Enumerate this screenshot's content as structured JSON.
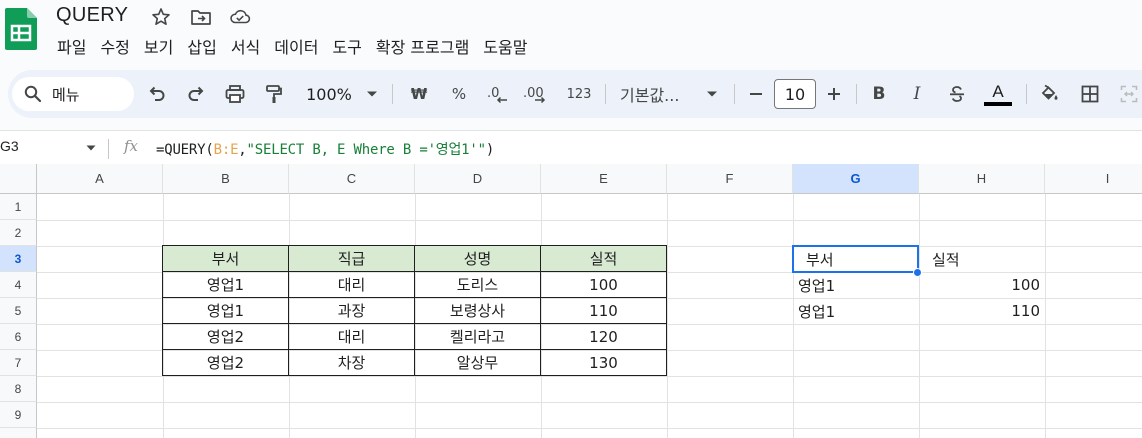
{
  "app": {
    "title": "QUERY",
    "accent_color": "#0f9d58"
  },
  "menu": [
    "파일",
    "수정",
    "보기",
    "삽입",
    "서식",
    "데이터",
    "도구",
    "확장 프로그램",
    "도움말"
  ],
  "toolbar": {
    "search_label": "메뉴",
    "zoom": "100%",
    "currency": "₩",
    "percent": "%",
    "format_number": "123",
    "font_family": "기본값...",
    "font_size": "10",
    "bold": "B",
    "italic": "I",
    "text_color_letter": "A"
  },
  "formula_bar": {
    "name_box": "G3",
    "fx": "fx",
    "formula_prefix": "=QUERY(",
    "formula_range": "B:E",
    "formula_comma": ",",
    "formula_string": "\"SELECT B, E Where B ='영업1'\"",
    "formula_suffix": ")"
  },
  "columns": [
    "A",
    "B",
    "C",
    "D",
    "E",
    "F",
    "G",
    "H",
    "I"
  ],
  "rows": [
    "1",
    "2",
    "3",
    "4",
    "5",
    "6",
    "7",
    "8",
    "9"
  ],
  "selected_cell": {
    "column": "G",
    "row": "3"
  },
  "source_table": {
    "headers": [
      "부서",
      "직급",
      "성명",
      "실적"
    ],
    "header_fill": "#d9ead3",
    "rows": [
      [
        "영업1",
        "대리",
        "도리스",
        "100"
      ],
      [
        "영업1",
        "과장",
        "보령상사",
        "110"
      ],
      [
        "영업2",
        "대리",
        "켈리라고",
        "120"
      ],
      [
        "영업2",
        "차장",
        "알상무",
        "130"
      ]
    ]
  },
  "query_result": {
    "headers": [
      "부서",
      "실적"
    ],
    "rows": [
      [
        "영업1",
        "100"
      ],
      [
        "영업1",
        "110"
      ]
    ]
  }
}
